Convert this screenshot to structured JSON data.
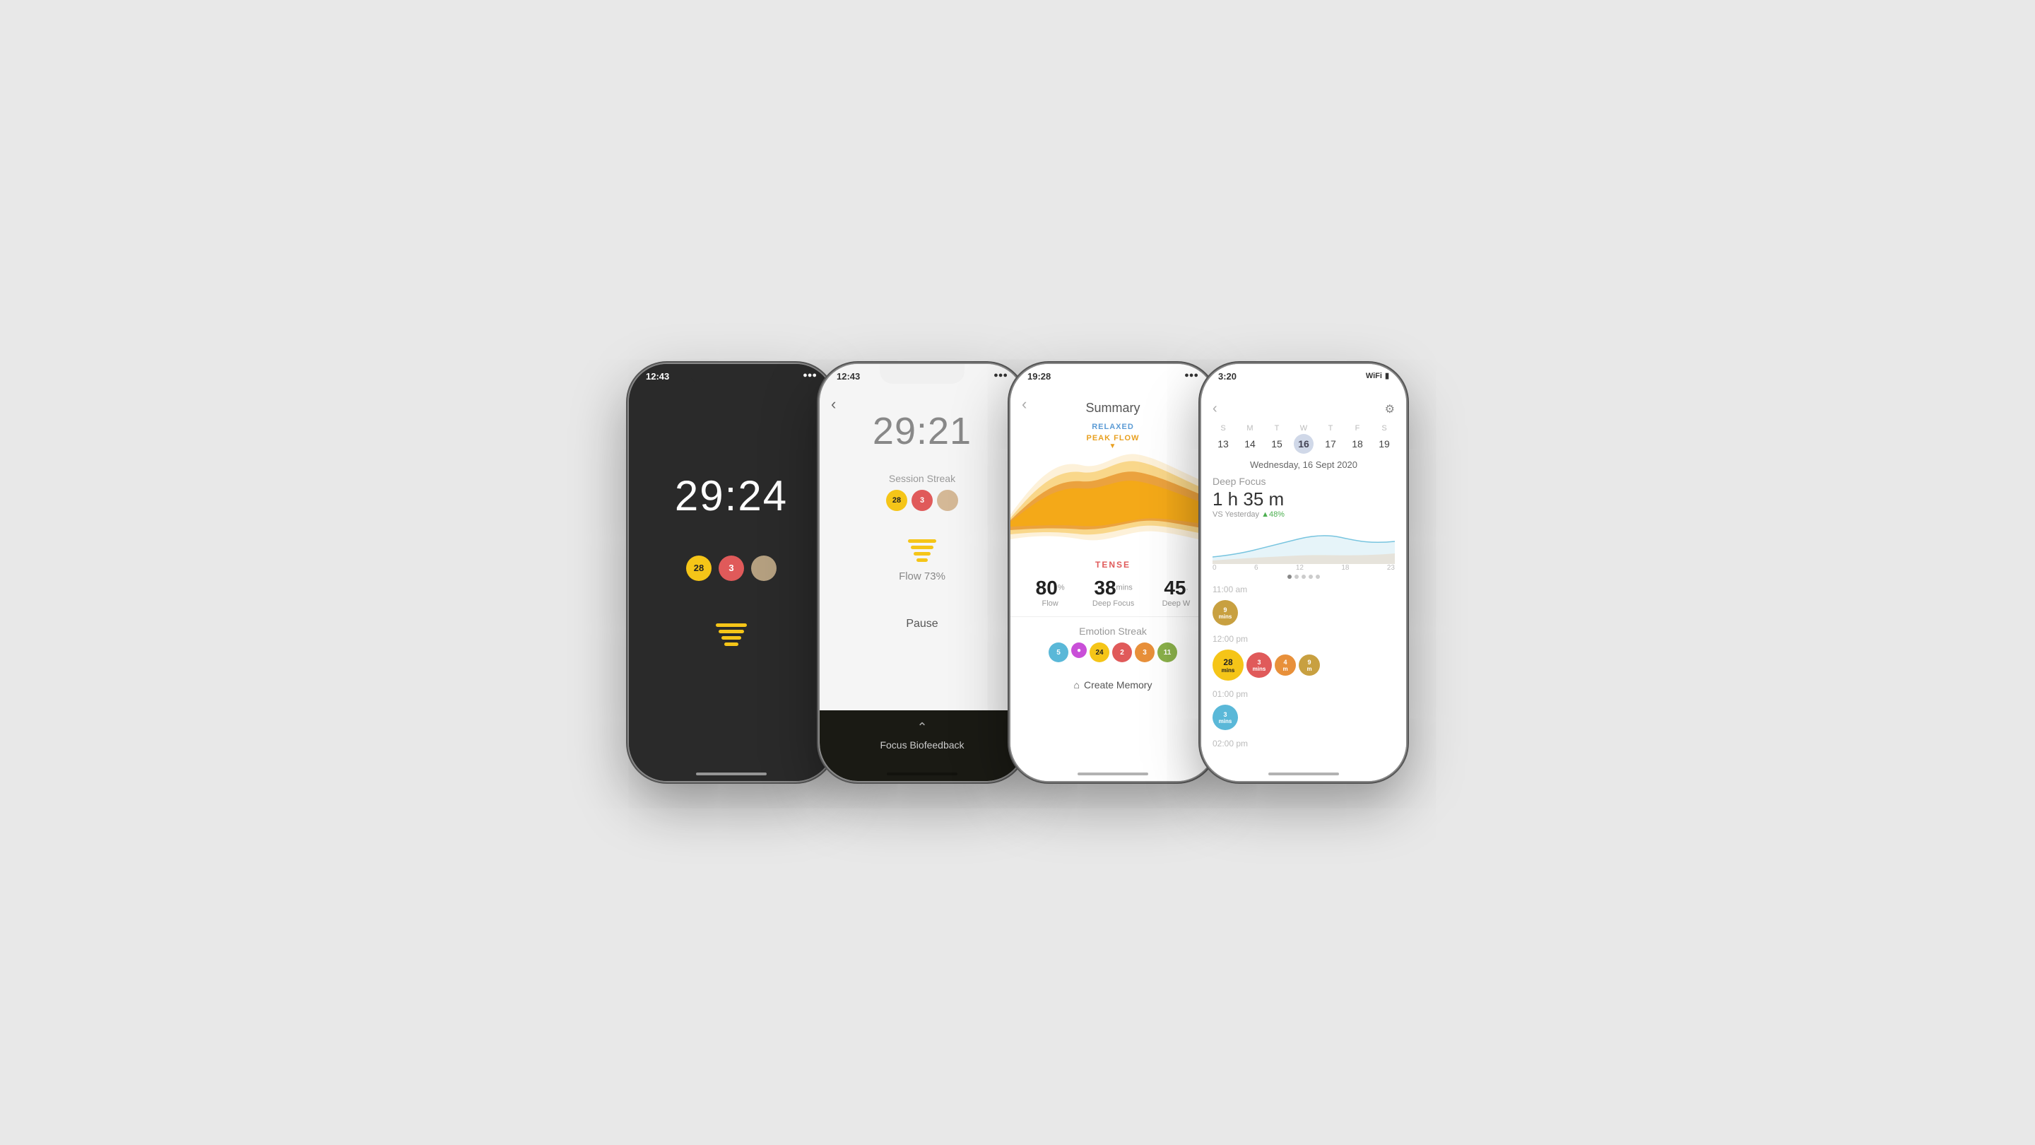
{
  "phones": [
    {
      "id": "phone-1",
      "theme": "dark",
      "status": {
        "time": "12:43",
        "icons": ""
      },
      "timer": "29:24",
      "dots": [
        {
          "value": "28",
          "color": "yellow"
        },
        {
          "value": "3",
          "color": "red"
        },
        {
          "value": "",
          "color": "tan"
        }
      ],
      "flow_icon": true
    },
    {
      "id": "phone-2",
      "theme": "light",
      "status": {
        "time": "12:43"
      },
      "timer": "29:21",
      "session_streak_label": "Session Streak",
      "dots": [
        {
          "value": "28",
          "color": "yellow"
        },
        {
          "value": "3",
          "color": "red"
        },
        {
          "value": "",
          "color": "tan"
        }
      ],
      "flow_label": "Flow 73%",
      "pause_label": "Pause",
      "biofeedback_label": "Focus Biofeedback"
    },
    {
      "id": "phone-3",
      "theme": "light",
      "status": {
        "time": "19:28"
      },
      "header": "Summary",
      "relaxed_label": "RELAXED",
      "peak_flow_label": "PEAK FLOW",
      "tense_label": "TENSE",
      "stats": [
        {
          "value": "80",
          "unit": "%",
          "label": "Flow"
        },
        {
          "value": "38",
          "unit": "mins",
          "label": "Deep Focus"
        },
        {
          "value": "45",
          "unit": ".",
          "label": "Deep W"
        }
      ],
      "emotion_streak_label": "Emotion Streak",
      "emotion_dots": [
        {
          "value": "5",
          "color": "#5ab8d8"
        },
        {
          "value": "●",
          "color": "#c94fd8",
          "size": "sm"
        },
        {
          "value": "24",
          "color": "#f5c518"
        },
        {
          "value": "2",
          "color": "#e05a5a"
        },
        {
          "value": "3",
          "color": "#e8903a"
        },
        {
          "value": "11",
          "color": "#8ab04a"
        }
      ],
      "create_memory": "Create Memory"
    },
    {
      "id": "phone-4",
      "theme": "light",
      "status": {
        "time": "3:20",
        "wifi": true,
        "battery": true
      },
      "calendar": {
        "days": [
          "S",
          "M",
          "T",
          "W",
          "T",
          "F",
          "S"
        ],
        "dates": [
          "13",
          "14",
          "15",
          "16",
          "17",
          "18",
          "19"
        ],
        "active_date": "16",
        "date_label": "Wednesday, 16 Sept 2020"
      },
      "deep_focus": {
        "title": "Deep Focus",
        "time": "1 h 35 m",
        "vs_yesterday": "VS Yesterday",
        "trend": "▲48%"
      },
      "chart_labels": [
        "0",
        "6",
        "12",
        "18",
        "23"
      ],
      "timeline": [
        {
          "time": "11:00 am",
          "bubbles": [
            {
              "value": "9\nmins",
              "color": "gold",
              "size": "md"
            }
          ]
        },
        {
          "time": "12:00 pm",
          "bubbles": [
            {
              "value": "28\nmins",
              "color": "yellow",
              "size": "lg"
            },
            {
              "value": "3\nmins",
              "color": "red",
              "size": "md"
            },
            {
              "value": "4\nmins",
              "color": "orange",
              "size": "sm"
            },
            {
              "value": "9\nmins",
              "color": "gold",
              "size": "sm"
            }
          ]
        },
        {
          "time": "01:00 pm",
          "bubbles": [
            {
              "value": "3\nmins",
              "color": "blue",
              "size": "md"
            }
          ]
        },
        {
          "time": "02:00 pm",
          "bubbles": []
        }
      ]
    }
  ]
}
